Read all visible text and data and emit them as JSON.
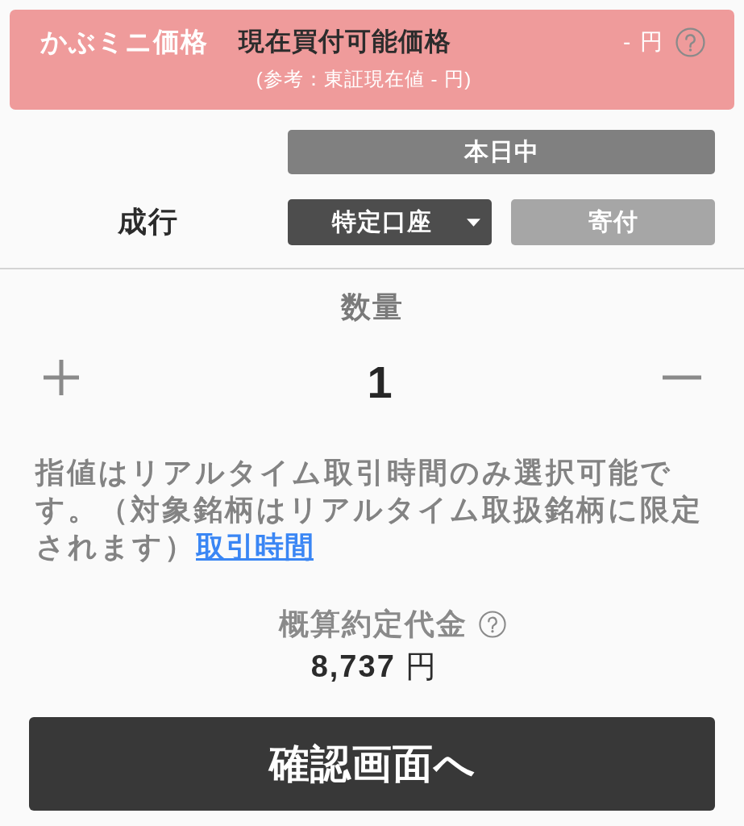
{
  "price_header": {
    "title": "かぶミニ価格",
    "label": "現在買付可能価格",
    "value": "- 円",
    "reference": "(参考：東証現在値 - 円)"
  },
  "order": {
    "period": {
      "label": "本日中",
      "disabled": false
    },
    "type_label": "成行",
    "account": {
      "label": "特定口座"
    },
    "timing": {
      "label": "寄付",
      "disabled": true
    }
  },
  "quantity": {
    "label": "数量",
    "value": "1"
  },
  "notice": {
    "text": "指値はリアルタイム取引時間のみ選択可能です。（対象銘柄はリアルタイム取扱銘柄に限定されます）",
    "link": "取引時間"
  },
  "estimate": {
    "label": "概算約定代金",
    "amount": "**8,737** 円"
  },
  "submit": {
    "label": "確認画面へ"
  }
}
